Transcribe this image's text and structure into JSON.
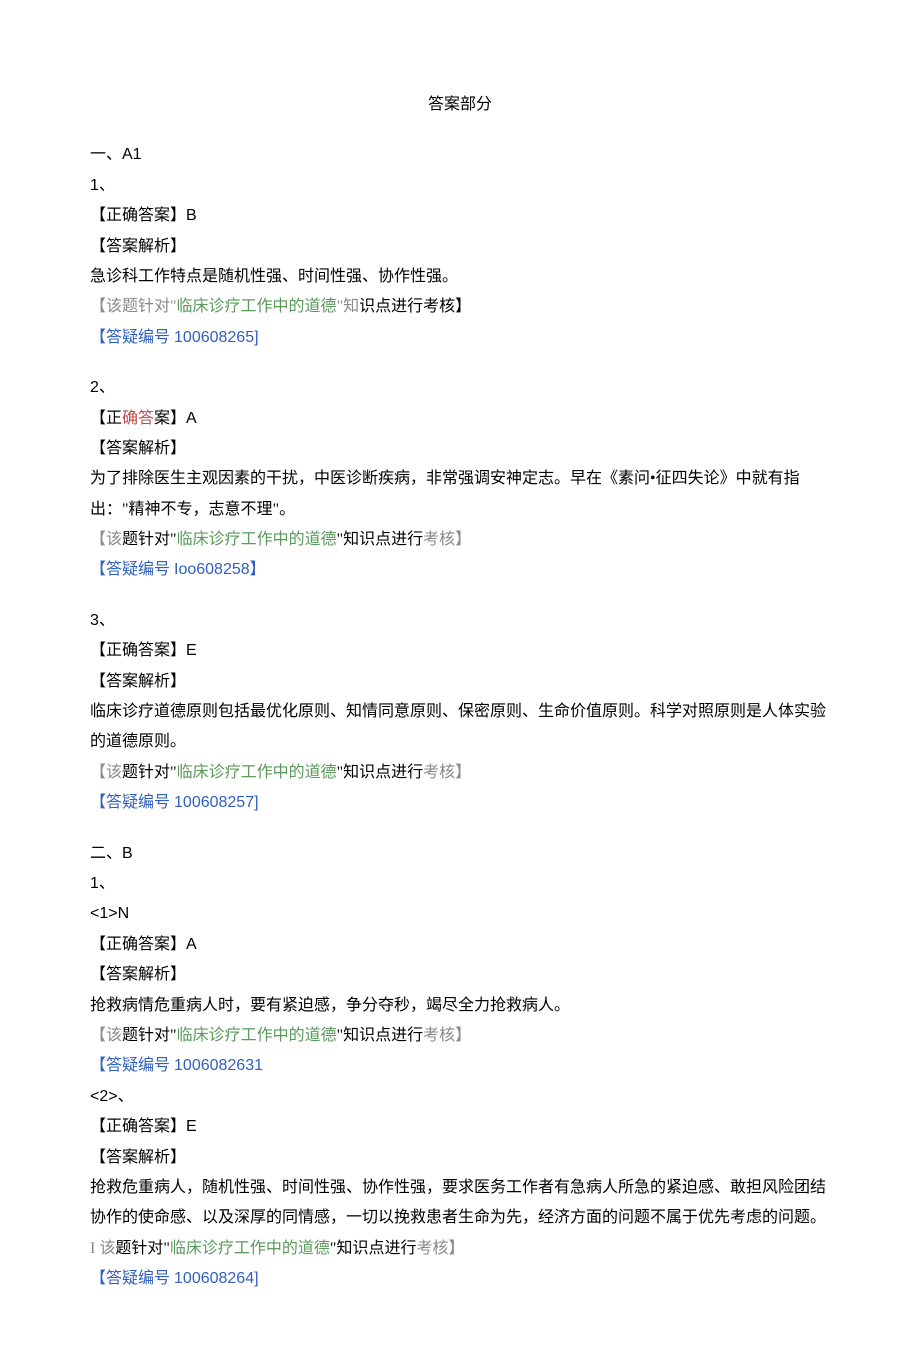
{
  "title": "答案部分",
  "knowledge_point": "临床诊疗工作中的道德",
  "src_prefix": "【该题针对\"",
  "src_suffix_a": "\"知识点进行",
  "src_suffix_b": "核】",
  "src_topic_word": "题针对\"",
  "kao": "考",
  "correct_label": "【正确答案】",
  "correct_label_pre": "【正",
  "correct_label_mid": "确答",
  "correct_label_post": "案】",
  "analysis_label": "【答案解析】",
  "qid_prefix": "【答疑编号 ",
  "sections": {
    "a1": {
      "heading": "一、A1",
      "q1": {
        "num": "1、",
        "answer": "B",
        "analysis": "急诊科工作特点是随机性强、时间性强、协作性强。",
        "qid": "100608265]"
      },
      "q2": {
        "num": "2、",
        "answer": "A",
        "analysis": "为了排除医生主观因素的干扰，中医诊断疾病，非常强调安神定志。早在《素问•征四失论》中就有指出：\"精神不专，志意不理\"。",
        "qid": "Ioo608258】"
      },
      "q3": {
        "num": "3、",
        "answer": "E",
        "analysis": "临床诊疗道德原则包括最优化原则、知情同意原则、保密原则、生命价值原则。科学对照原则是人体实验的道德原则。",
        "qid": "100608257]"
      }
    },
    "b": {
      "heading": "二、B",
      "q1": {
        "num": "1、",
        "sub1": {
          "num": "<1>N",
          "answer": "A",
          "analysis": "抢救病情危重病人时，要有紧迫感，争分夺秒，竭尽全力抢救病人。",
          "qid": "1006082631"
        },
        "sub2": {
          "num": "<2>、",
          "answer": "E",
          "analysis": "抢救危重病人，随机性强、时间性强、协作性强，要求医务工作者有急病人所急的紧迫感、敢担风险团结协作的使命感、以及深厚的同情感，一切以挽救患者生命为先，经济方面的问题不属于优先考虑的问题。",
          "src_pre": "I 该",
          "qid": "100608264]"
        }
      }
    }
  }
}
